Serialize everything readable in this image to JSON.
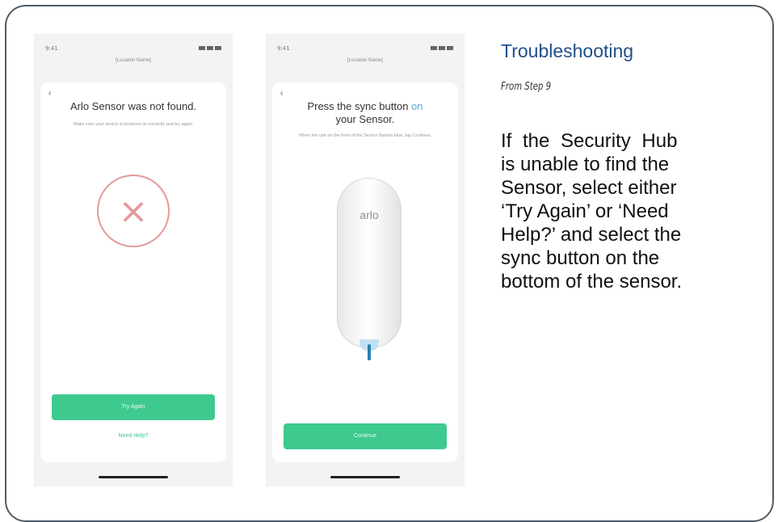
{
  "phone1": {
    "status_time": "9:41",
    "location": "[Location Name]",
    "back": "‹",
    "heading": "Arlo Sensor was not found.",
    "subtext": "Make sure your device is powered on correctly and try again.",
    "error_icon": "x-circle-icon",
    "primary_button": "Try Again",
    "help_link": "Need Help?"
  },
  "phone2": {
    "status_time": "9:41",
    "location": "[Location Name]",
    "back": "‹",
    "heading_part1": "Press the sync button",
    "heading_highlight": "on",
    "heading_part2": "your Sensor.",
    "subtext": "When the unit on the front of the Sensor flashes blue, tap Continue.",
    "sensor_logo": "arlo",
    "primary_button": "Continue"
  },
  "help": {
    "title": "Troubleshooting",
    "step": "From Step 9",
    "lines": [
      "If the Security Hub",
      "is unable to find the",
      "Sensor, select either",
      "‘Try Again’ or ‘Need",
      "Help?’ and select the",
      "sync button on the",
      "bottom of the sensor."
    ]
  },
  "colors": {
    "accent_green": "#3ec98f",
    "title_blue": "#1f4f8a",
    "error_red": "#e59a9a",
    "border": "#4d5b66"
  }
}
